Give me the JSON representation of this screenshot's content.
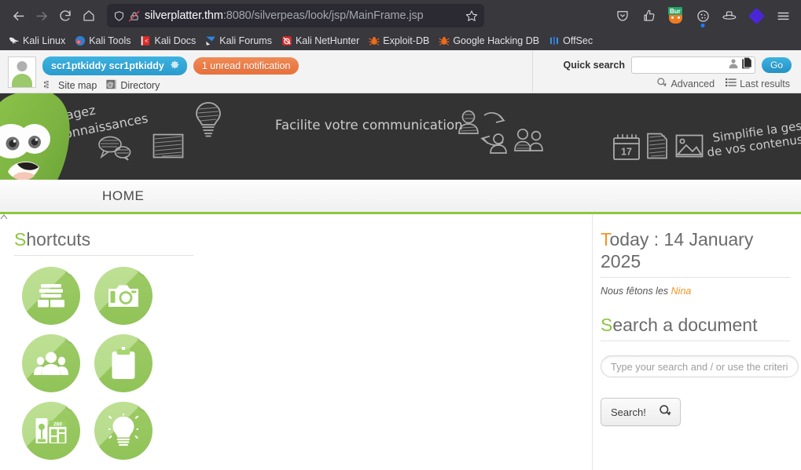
{
  "browser": {
    "nav": {
      "back_icon": "arrow-left-icon",
      "forward_icon": "arrow-right-icon",
      "reload_icon": "reload-icon",
      "home_icon": "home-icon"
    },
    "url_bar": {
      "shield_icon": "shield-icon",
      "lock_icon": "lock-crossed-out-icon",
      "host": "silverplatter.thm",
      "path": ":8080/silverpeas/look/jsp/MainFrame.jsp",
      "full_url": "silverplatter.thm:8080/silverpeas/look/jsp/MainFrame.jsp",
      "bookmark_icon": "star-icon"
    },
    "toolbar": [
      {
        "name": "pocket-icon",
        "label": "Pocket"
      },
      {
        "name": "thumbs-up-icon",
        "label": "FoxyProxy"
      },
      {
        "name": "burp-suite-icon",
        "label": "Burp",
        "badge": "Bur"
      },
      {
        "name": "cookie-icon",
        "label": "Cookie Editor"
      },
      {
        "name": "hat-icon",
        "label": "HackTools"
      },
      {
        "name": "diamond-icon",
        "label": "Wappalyzer"
      },
      {
        "name": "hamburger-menu-icon",
        "label": "Open application menu"
      }
    ],
    "bookmarks": [
      {
        "label": "Kali Linux",
        "icon": "kali-dragon-icon"
      },
      {
        "label": "Kali Tools",
        "icon": "kali-tools-icon"
      },
      {
        "label": "Kali Docs",
        "icon": "kali-docs-icon"
      },
      {
        "label": "Kali Forums",
        "icon": "kali-forums-icon"
      },
      {
        "label": "Kali NetHunter",
        "icon": "kali-nethunter-icon"
      },
      {
        "label": "Exploit-DB",
        "icon": "bug-icon"
      },
      {
        "label": "Google Hacking DB",
        "icon": "bug-icon"
      },
      {
        "label": "OffSec",
        "icon": "offsec-icon"
      }
    ]
  },
  "topbar": {
    "avatar_name": "avatar",
    "user_name": "scr1ptkiddy scr1ptkiddy",
    "user_gear_icon": "gear-icon",
    "notification": "1 unread notification",
    "links": [
      {
        "label": "Site map",
        "icon": "sitemap-icon"
      },
      {
        "label": "Directory",
        "icon": "directory-icon"
      }
    ],
    "quick_search": {
      "label": "Quick search",
      "value": "",
      "placeholder": "",
      "person_icon": "person-icon",
      "documents_icon": "documents-icon",
      "go_label": "Go"
    },
    "search_links": [
      {
        "label": "Advanced",
        "icon": "search-plus-icon"
      },
      {
        "label": "Last results",
        "icon": "list-icon"
      }
    ]
  },
  "banner": {
    "mascot_name": "silverpeas-pea-mascot",
    "slogans": [
      "Partagez",
      "vos connaissances",
      "Facilite votre communication",
      "Simplifie la gestion",
      "de vos contenus"
    ],
    "sketch_icons": [
      "speech-bubbles-icon",
      "photo-sketch-icon",
      "lightbulb-sketch-icon",
      "user-sync-icon",
      "people-sketch-icon",
      "calendar-sketch-icon",
      "document-sketch-icon",
      "image-sketch-icon"
    ],
    "calendar_day": "17",
    "bg_color": "#333333"
  },
  "nav": {
    "tabs": [
      {
        "label": "HOME",
        "active": true
      }
    ],
    "accent_color": "#8cc63f"
  },
  "shortcuts": {
    "heading_first": "S",
    "heading_rest": "hortcuts",
    "items": [
      {
        "name": "shortcut-library",
        "icon": "books-icon"
      },
      {
        "name": "shortcut-gallery",
        "icon": "camera-icon"
      },
      {
        "name": "shortcut-community",
        "icon": "people-icon"
      },
      {
        "name": "shortcut-tasks",
        "icon": "clipboard-icon"
      },
      {
        "name": "shortcut-kiosk",
        "icon": "newspaper-kiosk-icon",
        "badge": "280"
      },
      {
        "name": "shortcut-ideas",
        "icon": "lightbulb-icon"
      }
    ]
  },
  "today": {
    "heading_first": "T",
    "heading_rest": "oday : 14 January 2025",
    "date_text": "14 January 2025",
    "feast_prefix": "Nous fêtons les",
    "feast_name": "Nina"
  },
  "document_search": {
    "heading_first": "S",
    "heading_rest": "earch a document",
    "input_value": "",
    "input_placeholder": "Type your search and / or use the criteria below",
    "button_label": "Search!",
    "button_icon": "search-plus-icon"
  },
  "colors": {
    "green_accent": "#8cc63f",
    "orange_accent": "#f39422",
    "blue_pill": "#2a9cce",
    "orange_badge": "#e8703a",
    "banner_bg": "#333333",
    "chrome_bg": "#38383d"
  }
}
